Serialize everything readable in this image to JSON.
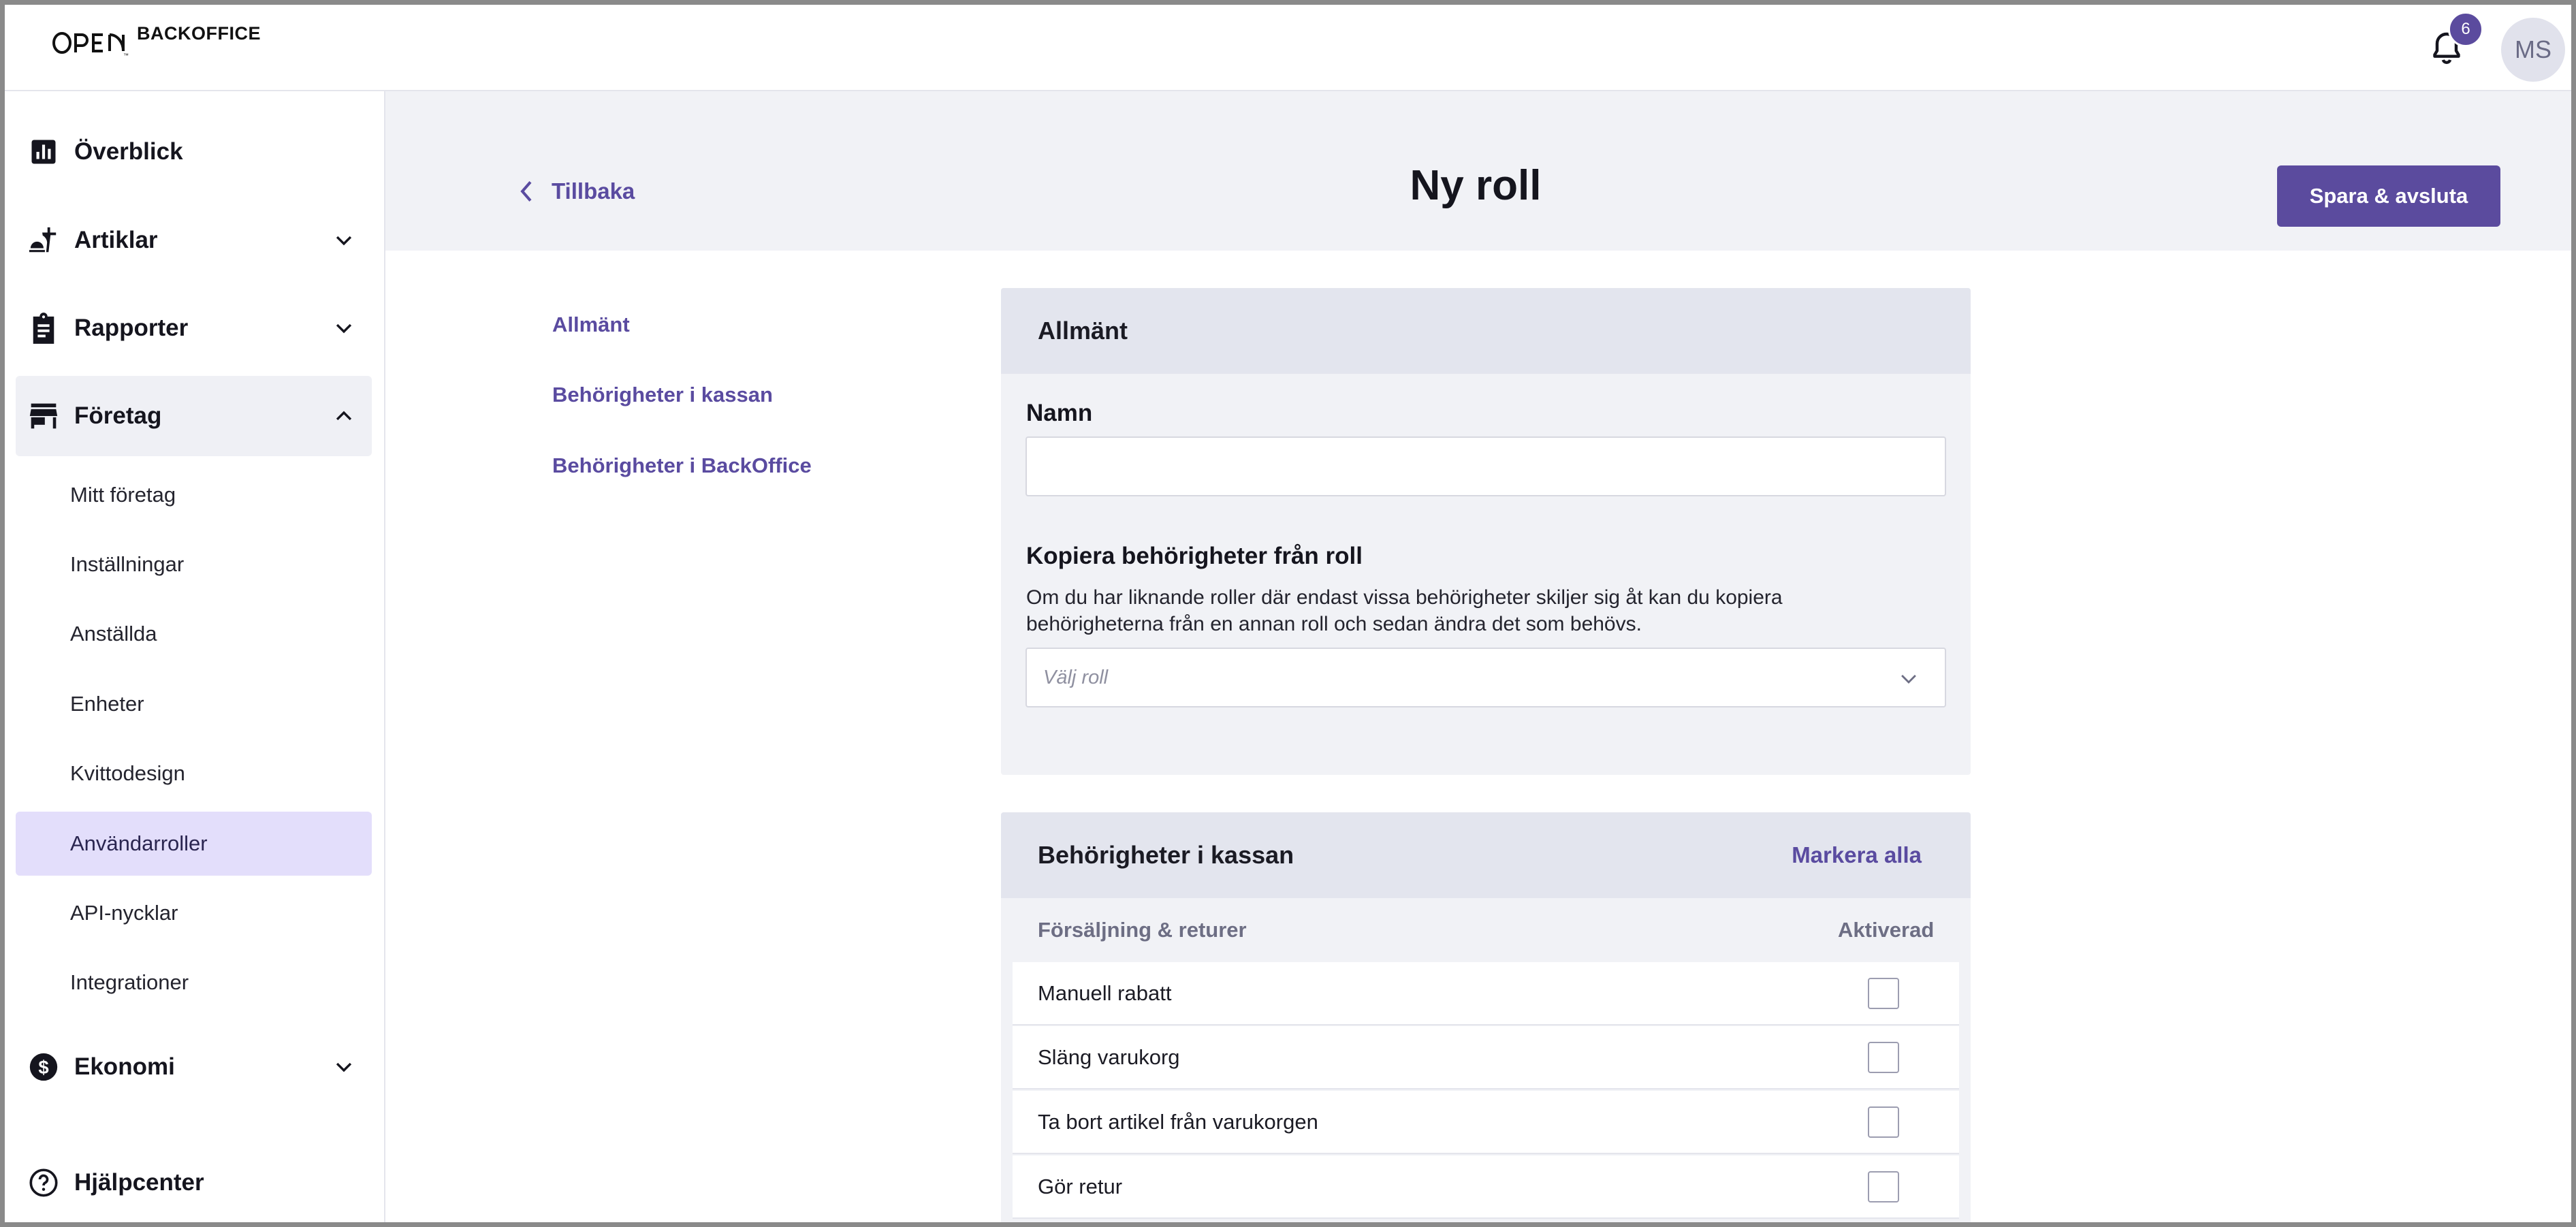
{
  "app": {
    "logo_text": "BACKOFFICE",
    "notifications_count": "6",
    "avatar_initials": "MS"
  },
  "sidebar": {
    "items": [
      {
        "label": "Överblick",
        "icon": "bar-chart-icon"
      },
      {
        "label": "Artiklar",
        "icon": "food-tray-icon"
      },
      {
        "label": "Rapporter",
        "icon": "clipboard-icon"
      },
      {
        "label": "Företag",
        "icon": "store-icon"
      },
      {
        "label": "Ekonomi",
        "icon": "dollar-circle-icon"
      },
      {
        "label": "Hjälpcenter",
        "icon": "help-circle-icon"
      }
    ],
    "foretag_sub": [
      "Mitt företag",
      "Inställningar",
      "Anställda",
      "Enheter",
      "Kvittodesign",
      "Användarroller",
      "API-nycklar",
      "Integrationer"
    ],
    "active_sub": "Användarroller"
  },
  "header": {
    "back_label": "Tillbaka",
    "title": "Ny roll",
    "save_label": "Spara & avsluta"
  },
  "anchors": [
    "Allmänt",
    "Behörigheter i kassan",
    "Behörigheter i BackOffice"
  ],
  "general": {
    "heading": "Allmänt",
    "name_label": "Namn",
    "name_value": "",
    "copy_label": "Kopiera behörigheter från roll",
    "copy_help_line1": "Om du har liknande roller där endast vissa behörigheter skiljer sig åt kan du kopiera",
    "copy_help_line2": "behörigheterna från en annan roll och sedan ändra det som behövs.",
    "role_placeholder": "Välj roll"
  },
  "pos_permissions": {
    "heading": "Behörigheter i kassan",
    "mark_all": "Markera alla",
    "col_group": "Försäljning & returer",
    "col_enabled": "Aktiverad",
    "rows": [
      {
        "label": "Manuell rabatt",
        "checked": false
      },
      {
        "label": "Släng varukorg",
        "checked": false
      },
      {
        "label": "Ta bort artikel från varukorgen",
        "checked": false
      },
      {
        "label": "Gör retur",
        "checked": false
      }
    ]
  },
  "colors": {
    "accent": "#5b4b9e",
    "header_band": "#f1f2f6",
    "active_item": "#e3defb"
  }
}
